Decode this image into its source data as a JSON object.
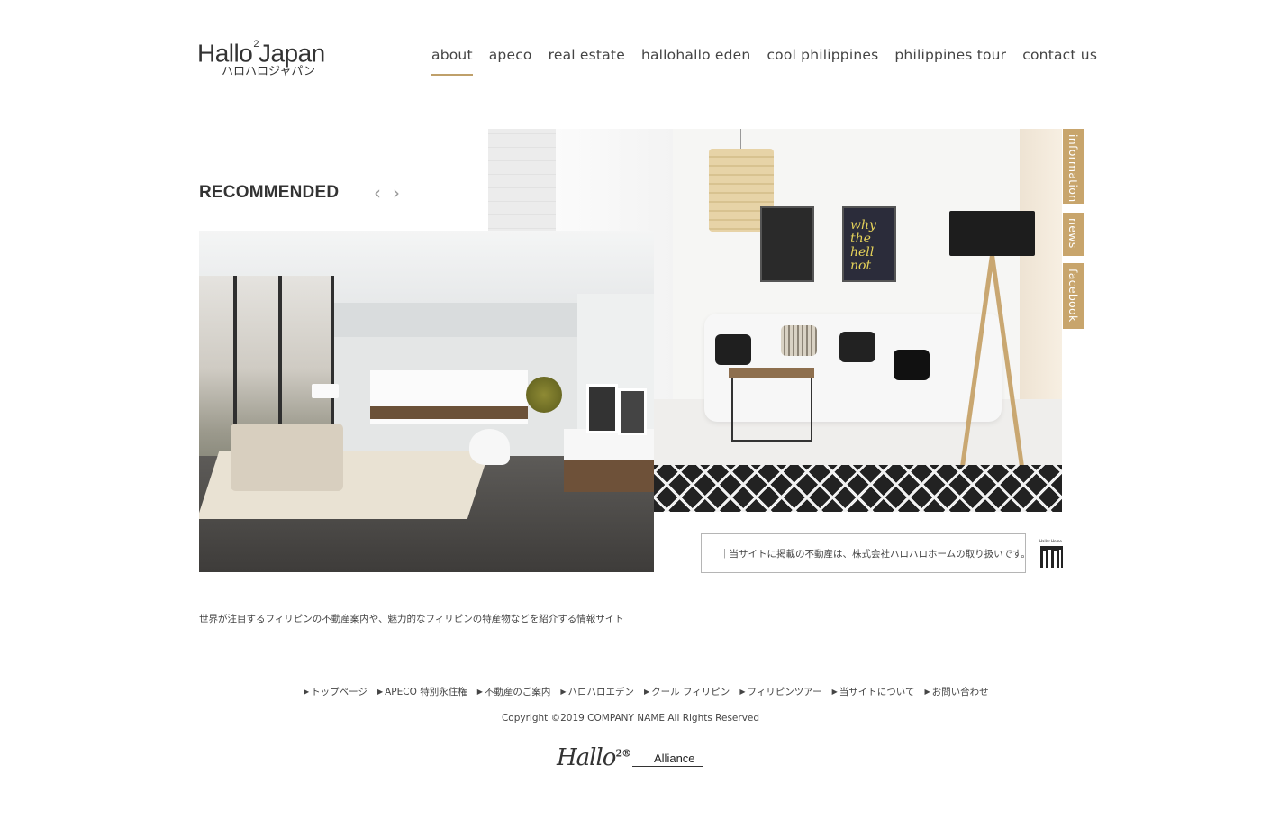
{
  "header": {
    "logo_main": "Hallo",
    "logo_sup": "2",
    "logo_main_2": "Japan",
    "logo_sub": "ハロハロジャパン",
    "nav": [
      {
        "label": "about",
        "active": true
      },
      {
        "label": "apeco",
        "active": false
      },
      {
        "label": "real estate",
        "active": false
      },
      {
        "label": "hallohallo eden",
        "active": false
      },
      {
        "label": "cool philippines",
        "active": false
      },
      {
        "label": "philippines tour",
        "active": false
      },
      {
        "label": "contact us",
        "active": false
      }
    ]
  },
  "recommended": {
    "title": "RECOMMENDED",
    "prev_icon": "‹",
    "next_icon": "›"
  },
  "hero": {
    "poster_text": "why the hell not"
  },
  "side_tabs": {
    "information": "information",
    "news": "news",
    "facebook": "facebook"
  },
  "notice": {
    "text": "｜当サイトに掲載の不動産は、株式会社ハロハロホームの取り扱いです。",
    "home_logo_label": "Hallo² Home"
  },
  "description": "世界が注目するフィリピンの不動産案内や、魅力的なフィリピンの特産物などを紹介する情報サイト",
  "footer": {
    "links": [
      "トップページ",
      "APECO 特別永住権",
      "不動産のご案内",
      "ハロハロエデン",
      "クール フィリピン",
      "フィリピンツアー",
      "当サイトについて",
      "お問い合わせ"
    ],
    "copyright": "Copyright ©2019 COMPANY NAME All Rights Reserved",
    "alliance_script": "Hallo",
    "alliance_sup": "2®",
    "alliance_word": "Alliance"
  },
  "colors": {
    "accent": "#c8a56c",
    "text": "#333333",
    "nav_underline": "#bfa06a"
  }
}
